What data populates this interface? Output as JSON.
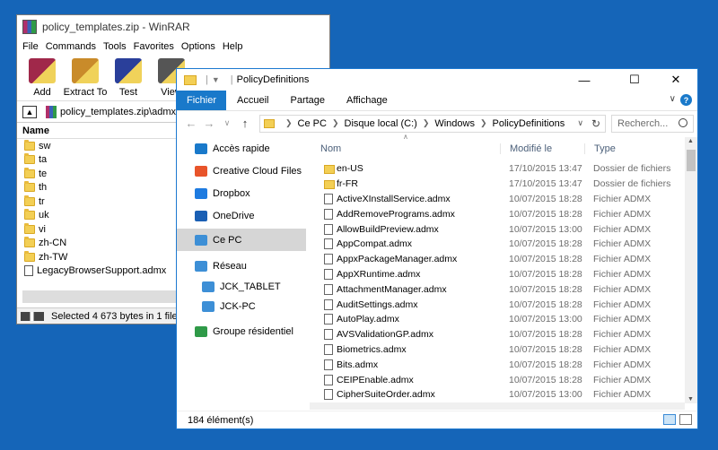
{
  "winrar": {
    "title": "policy_templates.zip - WinRAR",
    "menu": [
      "File",
      "Commands",
      "Tools",
      "Favorites",
      "Options",
      "Help"
    ],
    "toolbar": [
      {
        "label": "Add",
        "icon": "books-add-icon",
        "color": "#a0284a"
      },
      {
        "label": "Extract To",
        "icon": "folder-extract-icon",
        "color": "#c98b2a"
      },
      {
        "label": "Test",
        "icon": "test-book-icon",
        "color": "#2a3f9a"
      },
      {
        "label": "View",
        "icon": "glasses-view-icon",
        "color": "#555555"
      }
    ],
    "address": "policy_templates.zip\\admx",
    "column_name": "Name",
    "items": [
      {
        "name": "sw",
        "kind": "folder"
      },
      {
        "name": "ta",
        "kind": "folder"
      },
      {
        "name": "te",
        "kind": "folder"
      },
      {
        "name": "th",
        "kind": "folder"
      },
      {
        "name": "tr",
        "kind": "folder"
      },
      {
        "name": "uk",
        "kind": "folder"
      },
      {
        "name": "vi",
        "kind": "folder"
      },
      {
        "name": "zh-CN",
        "kind": "folder"
      },
      {
        "name": "zh-TW",
        "kind": "folder"
      },
      {
        "name": "LegacyBrowserSupport.admx",
        "kind": "file"
      }
    ],
    "status": "Selected 4 673 bytes in 1 file"
  },
  "explorer": {
    "title": "PolicyDefinitions",
    "ribbon_tabs": [
      "Fichier",
      "Accueil",
      "Partage",
      "Affichage"
    ],
    "breadcrumb": [
      "Ce PC",
      "Disque local (C:)",
      "Windows",
      "PolicyDefinitions"
    ],
    "search_placeholder": "Recherch...",
    "nav": [
      {
        "label": "Accès rapide",
        "icon": "star-quick-access-icon",
        "color": "#1979ca",
        "sub": false,
        "selected": false
      },
      {
        "label": "Creative Cloud Files",
        "icon": "creative-cloud-icon",
        "color": "#e8542a",
        "sub": false,
        "selected": false
      },
      {
        "label": "Dropbox",
        "icon": "dropbox-icon",
        "color": "#1e7be0",
        "sub": false,
        "selected": false
      },
      {
        "label": "OneDrive",
        "icon": "onedrive-icon",
        "color": "#1a5fb4",
        "sub": false,
        "selected": false
      },
      {
        "label": "Ce PC",
        "icon": "computer-icon",
        "color": "#3d8fd6",
        "sub": false,
        "selected": true
      },
      {
        "label": "Réseau",
        "icon": "network-icon",
        "color": "#3d8fd6",
        "sub": false,
        "selected": false
      },
      {
        "label": "JCK_TABLET",
        "icon": "computer-icon",
        "color": "#3d8fd6",
        "sub": true,
        "selected": false
      },
      {
        "label": "JCK-PC",
        "icon": "computer-icon",
        "color": "#3d8fd6",
        "sub": true,
        "selected": false
      },
      {
        "label": "Groupe résidentiel",
        "icon": "homegroup-icon",
        "color": "#2f9a48",
        "sub": false,
        "selected": false
      }
    ],
    "columns": {
      "name": "Nom",
      "modified": "Modifié le",
      "type": "Type"
    },
    "files": [
      {
        "name": "en-US",
        "date": "17/10/2015 13:47",
        "type": "Dossier de fichiers",
        "kind": "folder"
      },
      {
        "name": "fr-FR",
        "date": "17/10/2015 13:47",
        "type": "Dossier de fichiers",
        "kind": "folder"
      },
      {
        "name": "ActiveXInstallService.admx",
        "date": "10/07/2015 18:28",
        "type": "Fichier ADMX",
        "kind": "file"
      },
      {
        "name": "AddRemovePrograms.admx",
        "date": "10/07/2015 18:28",
        "type": "Fichier ADMX",
        "kind": "file"
      },
      {
        "name": "AllowBuildPreview.admx",
        "date": "10/07/2015 13:00",
        "type": "Fichier ADMX",
        "kind": "file"
      },
      {
        "name": "AppCompat.admx",
        "date": "10/07/2015 18:28",
        "type": "Fichier ADMX",
        "kind": "file"
      },
      {
        "name": "AppxPackageManager.admx",
        "date": "10/07/2015 18:28",
        "type": "Fichier ADMX",
        "kind": "file"
      },
      {
        "name": "AppXRuntime.admx",
        "date": "10/07/2015 18:28",
        "type": "Fichier ADMX",
        "kind": "file"
      },
      {
        "name": "AttachmentManager.admx",
        "date": "10/07/2015 18:28",
        "type": "Fichier ADMX",
        "kind": "file"
      },
      {
        "name": "AuditSettings.admx",
        "date": "10/07/2015 18:28",
        "type": "Fichier ADMX",
        "kind": "file"
      },
      {
        "name": "AutoPlay.admx",
        "date": "10/07/2015 13:00",
        "type": "Fichier ADMX",
        "kind": "file"
      },
      {
        "name": "AVSValidationGP.admx",
        "date": "10/07/2015 18:28",
        "type": "Fichier ADMX",
        "kind": "file"
      },
      {
        "name": "Biometrics.admx",
        "date": "10/07/2015 18:28",
        "type": "Fichier ADMX",
        "kind": "file"
      },
      {
        "name": "Bits.admx",
        "date": "10/07/2015 18:28",
        "type": "Fichier ADMX",
        "kind": "file"
      },
      {
        "name": "CEIPEnable.admx",
        "date": "10/07/2015 18:28",
        "type": "Fichier ADMX",
        "kind": "file"
      },
      {
        "name": "CipherSuiteOrder.admx",
        "date": "10/07/2015 13:00",
        "type": "Fichier ADMX",
        "kind": "file"
      }
    ],
    "status": "184 élément(s)"
  }
}
